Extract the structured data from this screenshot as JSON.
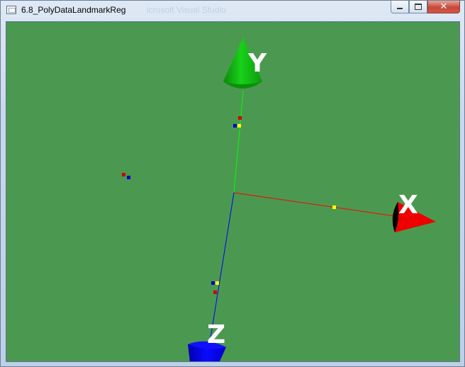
{
  "window": {
    "title": "6.8_PolyDataLandmarkReg",
    "ghost_text": "icrosoft Visual Studio",
    "buttons": {
      "minimize": "–",
      "maximize": "□",
      "close": "✕"
    }
  },
  "scene": {
    "background_color": "#4b9950",
    "axes": [
      {
        "name": "x",
        "label": "X",
        "color": "#ff0000"
      },
      {
        "name": "y",
        "label": "Y",
        "color": "#00c800"
      },
      {
        "name": "z",
        "label": "Z",
        "color": "#0000ff"
      }
    ],
    "landmark_colors": {
      "source": "#cc0000",
      "target": "#0000cc",
      "transformed": "#ffff00"
    }
  }
}
